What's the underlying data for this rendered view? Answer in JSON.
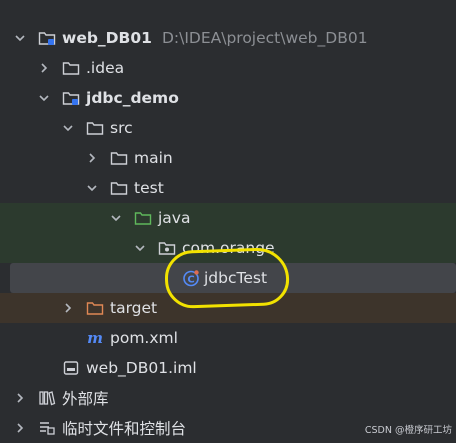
{
  "tree": {
    "root": {
      "name": "web_DB01",
      "path": "D:\\IDEA\\project\\web_DB01"
    },
    "idea": {
      "name": ".idea"
    },
    "module": {
      "name": "jdbc_demo"
    },
    "src": {
      "name": "src"
    },
    "main": {
      "name": "main"
    },
    "test": {
      "name": "test"
    },
    "java": {
      "name": "java"
    },
    "package": {
      "name": "com.orange"
    },
    "class_file": {
      "name": "jdbcTest"
    },
    "target": {
      "name": "target"
    },
    "pom": {
      "name": "pom.xml"
    },
    "iml": {
      "name": "web_DB01.iml"
    },
    "external_libs": {
      "name": "外部库"
    },
    "scratches": {
      "name": "临时文件和控制台"
    }
  },
  "watermark": "CSDN @橙序研工坊",
  "colors": {
    "background": "#2b2d30",
    "test_source_band": "#2c3a2e",
    "selection": "#43454a",
    "excluded_band": "#3d342b",
    "annotation": "#f2e200"
  }
}
